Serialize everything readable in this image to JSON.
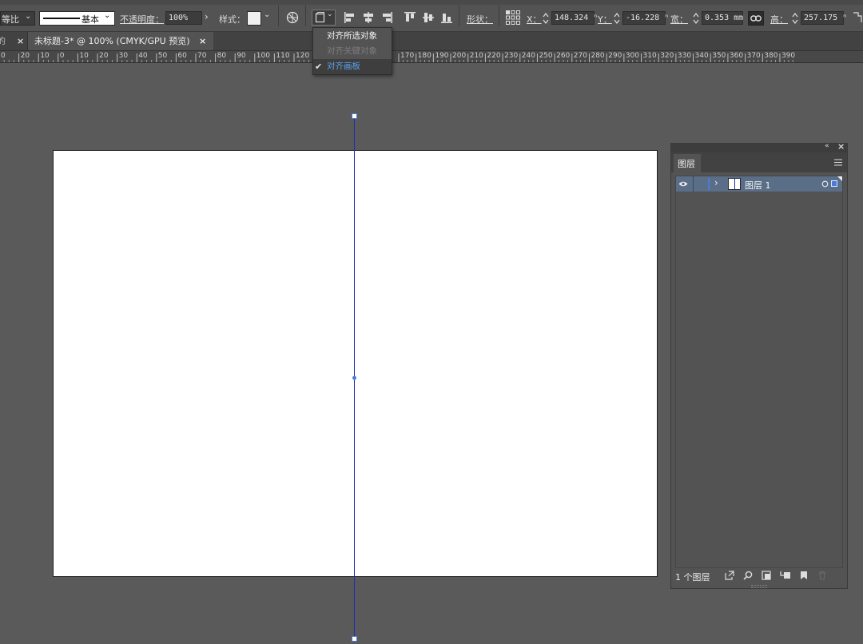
{
  "control_bar": {
    "ratio_label": "等比",
    "stroke_label": "基本",
    "opacity_label": "不透明度",
    "opacity_value": "100%",
    "style_label": "样式",
    "shape_label": "形状",
    "x_label": "X",
    "x_value": "148.324 ⁿ",
    "y_label": "Y",
    "y_value": "-16.228 ⁿ",
    "w_label": "宽",
    "w_value": "0.353 mm",
    "h_label": "高",
    "h_value": "257.175 ⁿ"
  },
  "tabs": {
    "prev_tab_fragment": "的",
    "active_tab_label": "未标题-3* @ 100% (CMYK/GPU 预览)",
    "close_glyph": "×"
  },
  "ruler": {
    "labels": [
      "0",
      "20",
      "10",
      "0",
      "10",
      "20",
      "30",
      "40",
      "50",
      "60",
      "70",
      "80",
      "90",
      "100",
      "110",
      "120",
      "170",
      "180",
      "190",
      "200",
      "210",
      "220",
      "230",
      "240",
      "250",
      "260",
      "270",
      "280",
      "290",
      "300",
      "310",
      "320",
      "330",
      "340",
      "350",
      "360",
      "370",
      "380",
      "390"
    ]
  },
  "align_menu": {
    "items": [
      {
        "label": "对齐所选对象",
        "state": "normal"
      },
      {
        "label": "对齐关键对象",
        "state": "disabled"
      },
      {
        "label": "对齐画板",
        "state": "checked"
      }
    ]
  },
  "layers_panel": {
    "title": "图层",
    "layer_name": "图层 1",
    "footer_count": "1 个图层",
    "layer_color": "#4a7bd8"
  },
  "colors": {
    "guide_line": "#1c2fa8",
    "selection_accent": "#4a7bd8",
    "canvas": "#5a5a5a"
  }
}
